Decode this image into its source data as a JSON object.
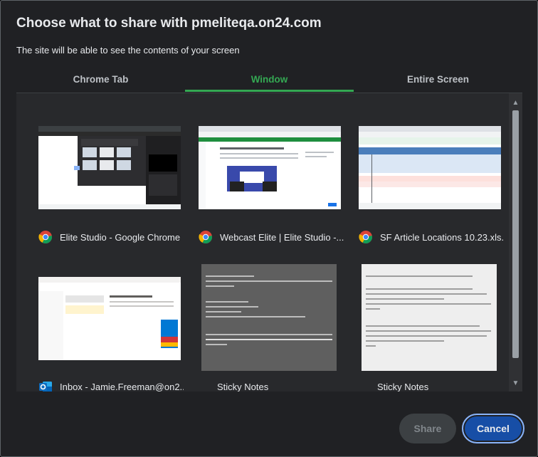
{
  "dialog": {
    "title": "Choose what to share with pmeliteqa.on24.com",
    "subtitle": "The site will be able to see the contents of your screen"
  },
  "tabs": [
    {
      "label": "Chrome Tab",
      "active": false
    },
    {
      "label": "Window",
      "active": true
    },
    {
      "label": "Entire Screen",
      "active": false
    }
  ],
  "windows": [
    {
      "label": "Elite Studio - Google Chrome",
      "icon": "chrome-icon"
    },
    {
      "label": "Webcast Elite | Elite Studio -...",
      "icon": "chrome-icon"
    },
    {
      "label": "SF Article Locations 10.23.xls...",
      "icon": "chrome-icon"
    },
    {
      "label": "Inbox - Jamie.Freeman@on2...",
      "icon": "outlook-icon"
    },
    {
      "label": "Sticky Notes",
      "icon": "sticky-notes-icon"
    },
    {
      "label": "Sticky Notes",
      "icon": "sticky-notes-icon"
    }
  ],
  "buttons": {
    "share": "Share",
    "cancel": "Cancel"
  },
  "colors": {
    "accent": "#34a853",
    "cancel_bg": "#174ea6",
    "focus_ring": "#8ab4f8"
  }
}
